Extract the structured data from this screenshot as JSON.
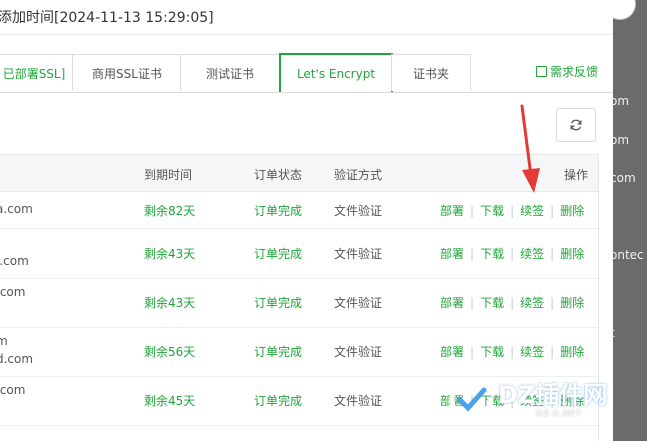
{
  "header": {
    "add_time": "添加时间[2024-11-13 15:29:05]"
  },
  "tabs": [
    {
      "label": "已部署SSL]"
    },
    {
      "label": "商用SSL证书"
    },
    {
      "label": "测试证书"
    },
    {
      "label": "Let's Encrypt"
    },
    {
      "label": "证书夹"
    }
  ],
  "feedback": {
    "label": "需求反馈"
  },
  "refresh": {
    "icon": "refresh-icon"
  },
  "table": {
    "headers": {
      "expire": "到期时间",
      "status": "订单状态",
      "verify": "验证方式",
      "ops": "操作"
    },
    "rows": [
      {
        "domain1": "",
        "domain2": "a.com",
        "expire": "剩余82天",
        "status": "订单完成",
        "verify": "文件验证"
      },
      {
        "domain1": "",
        "domain2": "l.com",
        "expire": "剩余43天",
        "status": "订单完成",
        "verify": "文件验证"
      },
      {
        "domain1": ".com",
        "domain2": "",
        "expire": "剩余43天",
        "status": "订单完成",
        "verify": "文件验证"
      },
      {
        "domain1": "m",
        "domain2": "d.com",
        "expire": "剩余56天",
        "status": "订单完成",
        "verify": "文件验证"
      },
      {
        "domain1": ".com",
        "domain2": "",
        "expire": "剩余45天",
        "status": "订单完成",
        "verify": "文件验证"
      }
    ],
    "actions": {
      "deploy": "部署",
      "download": "下载",
      "renew": "续签",
      "delete": "删除"
    }
  },
  "background_edge": {
    "items": [
      "om",
      "om",
      "com",
      "ontec",
      "t"
    ]
  },
  "watermark": {
    "text": "DZ插件网",
    "sub": "DZ-X.NET"
  },
  "colors": {
    "accent": "#20a53a",
    "arrow": "#e53935"
  }
}
